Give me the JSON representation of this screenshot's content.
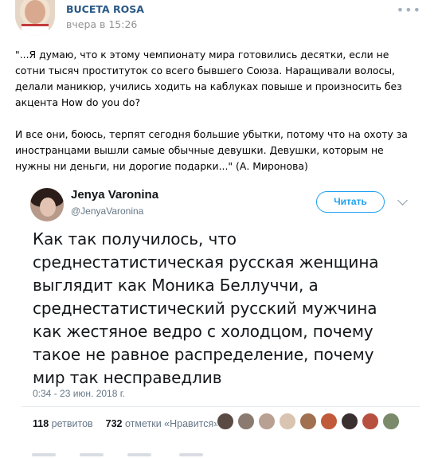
{
  "post": {
    "author": "BUCETA ROSA",
    "time": "вчера в 15:26",
    "paragraph1": "\"...Я думаю, что к этому чемпионату мира готовились десятки, если не сотни тысяч проституток со всего бывшего Союза. Наращивали волосы, делали маникюр, учились ходить на каблуках повыше и произносить без акцента How do you do?",
    "paragraph2": "И все они, боюсь, терпят сегодня большие убытки, потому что на охоту за иностранцами вышли самые обычные девушки. Девушки, которым не нужны ни деньги, ни дорогие подарки...\" (А. Миронова)"
  },
  "tweet": {
    "name": "Jenya Varonina",
    "handle": "@JenyaVaronina",
    "follow_label": "Читать",
    "text": "Как так получилось, что среднестатистическая русская женщина выглядит как Моника Беллуччи, а среднестатистический русский мужчина как жестяное ведро с холодцом, почему такое не равное распределение, почему мир так несправедлив",
    "date": "0:34 - 23 июн. 2018 г.",
    "retweets_count": "118",
    "retweets_label": "ретвитов",
    "likes_count": "732",
    "likes_label": "отметки «Нравится»"
  },
  "icons": {
    "more": "more-icon",
    "chevron": "chevron-down-icon"
  },
  "colors": {
    "author_link": "#2a5885",
    "twitter_blue": "#1da1f2",
    "muted": "#657786"
  },
  "liker_colors": [
    "#5a4a44",
    "#8a7a70",
    "#b8a092",
    "#d8c4b0",
    "#a07050",
    "#c05a3a",
    "#3a3030",
    "#b85040",
    "#7a8a6a"
  ]
}
